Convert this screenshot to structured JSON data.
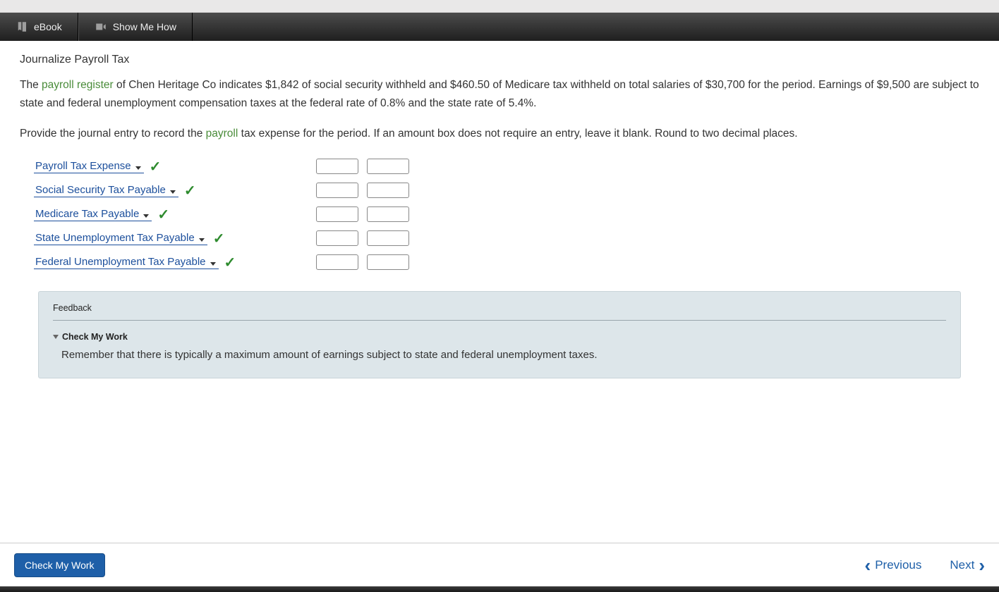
{
  "toolbar": {
    "ebook_label": "eBook",
    "show_me_how_label": "Show Me How"
  },
  "question": {
    "title": "Journalize Payroll Tax",
    "p1_pre": "The ",
    "p1_kw": "payroll register",
    "p1_post": " of Chen Heritage Co indicates $1,842 of social security withheld and $460.50 of Medicare tax withheld on total salaries of $30,700 for the period. Earnings of $9,500 are subject to state and federal unemployment compensation taxes at the federal rate of 0.8% and the state rate of 5.4%.",
    "p2_pre": "Provide the journal entry to record the ",
    "p2_kw": "payroll",
    "p2_post": " tax expense for the period. If an amount box does not require an entry, leave it blank. Round to two decimal places."
  },
  "rows": [
    {
      "account": "Payroll Tax Expense",
      "debit": "",
      "credit": ""
    },
    {
      "account": "Social Security Tax Payable",
      "debit": "",
      "credit": ""
    },
    {
      "account": "Medicare Tax Payable",
      "debit": "",
      "credit": ""
    },
    {
      "account": "State Unemployment Tax Payable",
      "debit": "",
      "credit": ""
    },
    {
      "account": "Federal Unemployment Tax Payable",
      "debit": "",
      "credit": ""
    }
  ],
  "feedback": {
    "heading": "Feedback",
    "cmw_label": "Check My Work",
    "text": "Remember that there is typically a maximum amount of earnings subject to state and federal unemployment taxes."
  },
  "footer": {
    "check_btn": "Check My Work",
    "prev": "Previous",
    "next": "Next"
  }
}
